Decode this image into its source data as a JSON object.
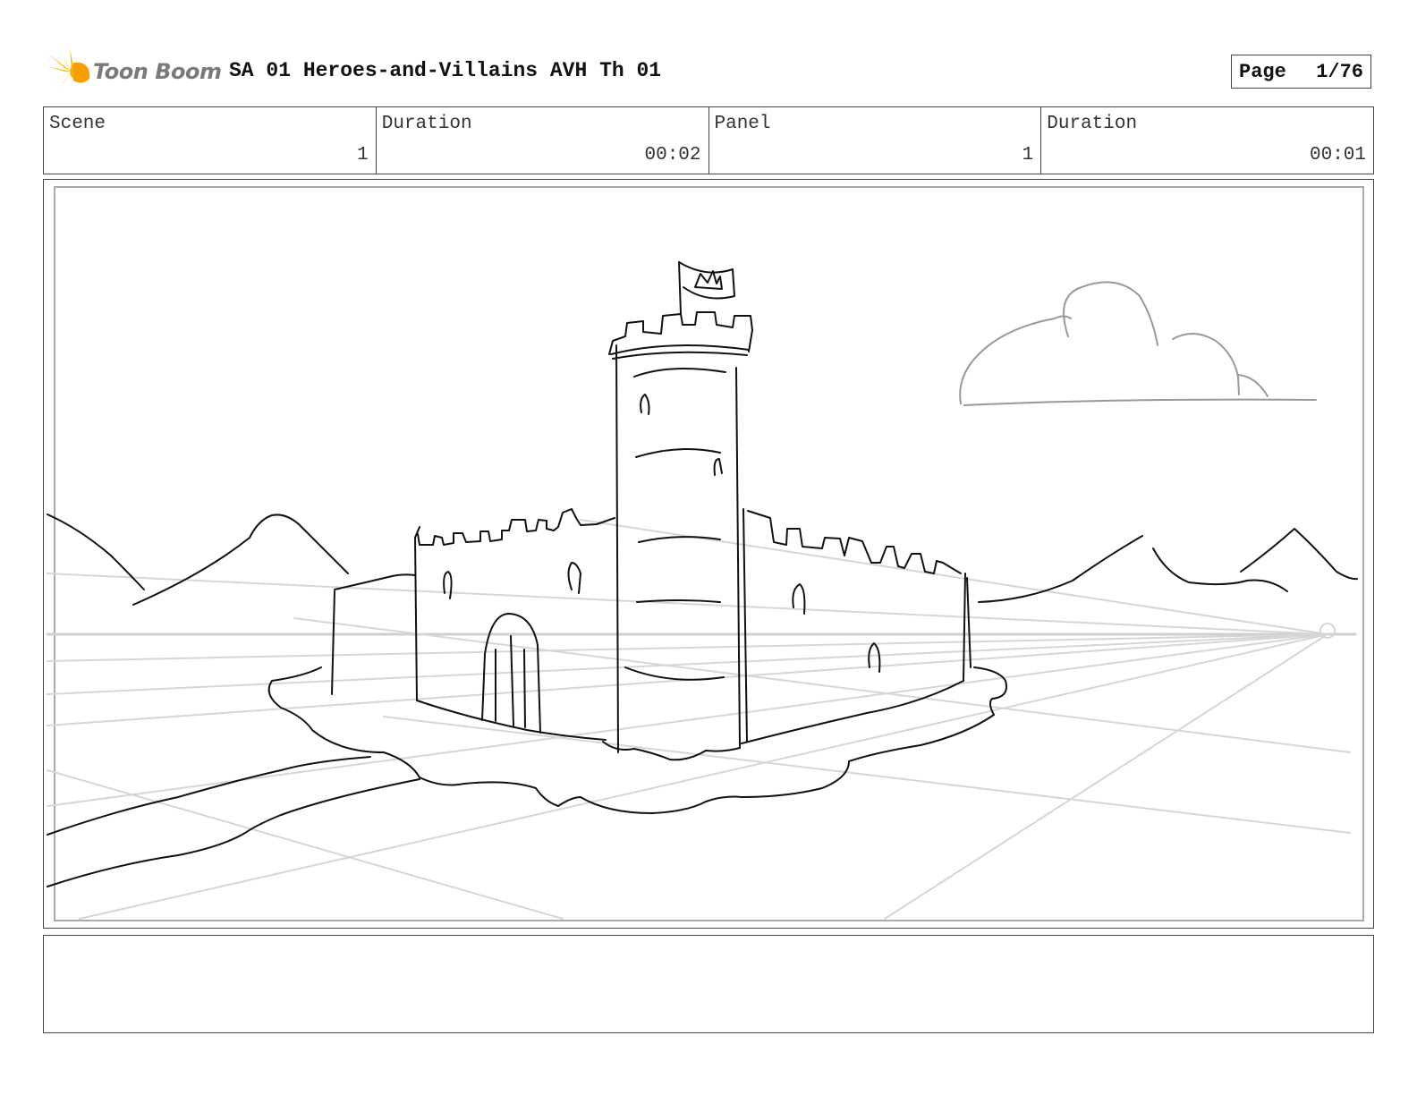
{
  "header": {
    "logo_icon": "toon-boom-burst-icon",
    "logo_text": "Toon Boom",
    "title": "SA 01 Heroes-and-Villains AVH Th 01",
    "page_label": "Page",
    "page_value": "1/76"
  },
  "info": [
    {
      "label": "Scene",
      "value": "1"
    },
    {
      "label": "Duration",
      "value": "00:02"
    },
    {
      "label": "Panel",
      "value": "1"
    },
    {
      "label": "Duration",
      "value": "00:01"
    }
  ],
  "caption": "",
  "colors": {
    "logo_accent": "#f5c518",
    "logo_text": "#7a7a7a",
    "border": "#444444",
    "sketch": "#111111",
    "guide": "#cccccc"
  }
}
